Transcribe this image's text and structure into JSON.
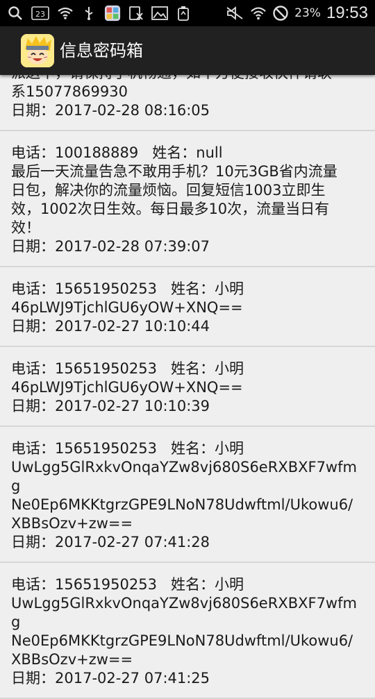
{
  "status_bar": {
    "battery": "23%",
    "time": "19:53",
    "sim_badge": "23"
  },
  "app_bar": {
    "title": "信息密码箱"
  },
  "messages": [
    {
      "lines": [
        "派送中，请保持手机畅通，如不方便接收快件请联",
        "系15077869930"
      ],
      "date": "日期：2017-02-28 08:16:05"
    },
    {
      "header": "电话：100188889   姓名：null",
      "lines": [
        "最后一天流量告急不敢用手机？10元3GB省内流量",
        "日包，解决你的流量烦恼。回复短信1003立即生",
        "效，1002次日生效。每日最多10次，流量当日有",
        "效！"
      ],
      "date": "日期：2017-02-28 07:39:07"
    },
    {
      "header": "电话：15651950253   姓名：小明",
      "lines": [
        "46pLWJ9TjchlGU6yOW+XNQ=="
      ],
      "date": "日期：2017-02-27 10:10:44"
    },
    {
      "header": "电话：15651950253   姓名：小明",
      "lines": [
        "46pLWJ9TjchlGU6yOW+XNQ=="
      ],
      "date": "日期：2017-02-27 10:10:39"
    },
    {
      "header": "电话：15651950253   姓名：小明",
      "lines": [
        "UwLgg5GlRxkvOnqaYZw8vj680S6eRXBXF7wfmg",
        "Ne0Ep6MKKtgrzGPE9LNoN78Udwftml/Ukowu6/",
        "XBBsOzv+zw=="
      ],
      "date": "日期：2017-02-27 07:41:28"
    },
    {
      "header": "电话：15651950253   姓名：小明",
      "lines": [
        "UwLgg5GlRxkvOnqaYZw8vj680S6eRXBXF7wfmg",
        "Ne0Ep6MKKtgrzGPE9LNoN78Udwftml/Ukowu6/",
        "XBBsOzv+zw=="
      ],
      "date": "日期：2017-02-27 07:41:25"
    }
  ]
}
